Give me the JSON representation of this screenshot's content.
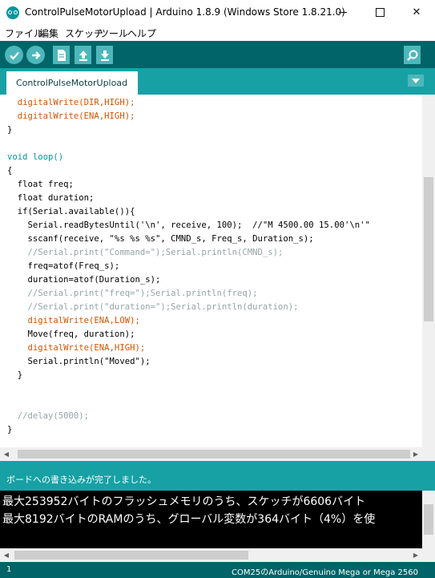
{
  "window": {
    "title": "ControlPulseMotorUpload | Arduino 1.8.9 (Windows Store 1.8.21.0)",
    "controls": {
      "minimize": "—",
      "maximize": "☐",
      "close": "✕"
    }
  },
  "menu": [
    "ファイル",
    "編集",
    "スケッチ",
    "ツール",
    "ヘルプ"
  ],
  "toolbar": {
    "buttons": [
      {
        "name": "verify",
        "icon": "checkmark-icon"
      },
      {
        "name": "upload",
        "icon": "arrow-right-icon"
      },
      {
        "name": "new",
        "icon": "new-file-icon"
      },
      {
        "name": "open",
        "icon": "arrow-up-icon"
      },
      {
        "name": "save",
        "icon": "arrow-down-icon"
      },
      {
        "name": "serial-monitor",
        "icon": "magnifier-icon"
      }
    ]
  },
  "tabs": [
    {
      "label": "ControlPulseMotorUpload",
      "active": true
    }
  ],
  "editor": {
    "lines": [
      "  digitalWrite(DIR,HIGH);",
      "  digitalWrite(ENA,HIGH);",
      "}",
      "",
      "void loop()",
      "{",
      "  float freq;",
      "  float duration;",
      "  if(Serial.available()){",
      "    Serial.readBytesUntil('\\n', receive, 100);  //\"M 4500.00 15.00'\\n'\"",
      "    sscanf(receive, \"%s %s %s\", CMND_s, Freq_s, Duration_s);",
      "    //Serial.print(\"Command=\");Serial.println(CMND_s);",
      "    freq=atof(Freq_s);",
      "    duration=atof(Duration_s);",
      "    //Serial.print(\"freq=\");Serial.println(freq);",
      "    //Serial.print(\"duration=\");Serial.println(duration);",
      "    digitalWrite(ENA,LOW);",
      "    Move(freq, duration);",
      "    digitalWrite(ENA,HIGH);",
      "    Serial.println(\"Moved\");",
      "  }",
      "",
      "",
      "  //delay(5000);",
      "}"
    ]
  },
  "status": {
    "message": "ボードへの書き込みが完了しました。"
  },
  "console": {
    "lines": [
      "最大253952バイトのフラッシュメモリのうち、スケッチが6606バイト",
      "最大8192バイトのRAMのうち、グローバル変数が364バイト（4%）を使"
    ]
  },
  "footer": {
    "line_number": "1",
    "board": "COM25のArduino/Genuino Mega or Mega 2560"
  },
  "colors": {
    "toolbar": "#006468",
    "tabstrip": "#17a1a5",
    "button": "#4db7bb",
    "keyword": "#d35400",
    "type": "#00979c",
    "string": "#005c5f",
    "comment": "#95a5a6"
  }
}
